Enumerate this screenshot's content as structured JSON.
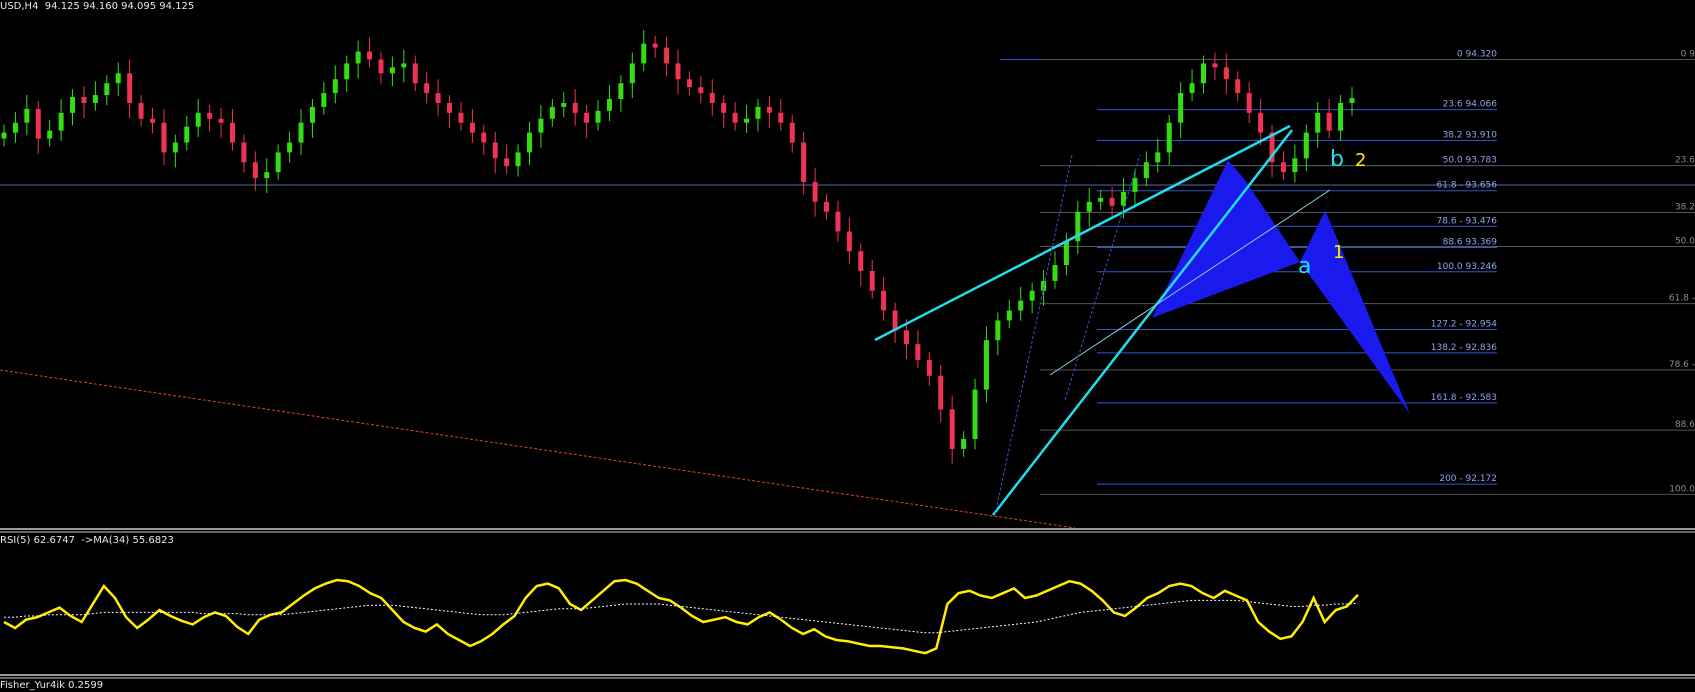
{
  "main": {
    "header": "USD,H4  94.125 94.160 94.095 94.125",
    "wave_labels": {
      "a": "a",
      "b": "b",
      "one": "1",
      "two": "2"
    },
    "fib_right_a": [
      {
        "label": "0 94.320",
        "level": 94.32
      },
      {
        "label": "23.6 94.066",
        "level": 94.066
      },
      {
        "label": "38.2 93.910",
        "level": 93.91
      },
      {
        "label": "50.0 93.783",
        "level": 93.783
      },
      {
        "label": "61.8 - 93.656",
        "level": 93.656
      },
      {
        "label": "78.6 - 93.476",
        "level": 93.476
      },
      {
        "label": "88.6 93.369",
        "level": 93.369
      },
      {
        "label": "100.0 93.246",
        "level": 93.246
      },
      {
        "label": "127.2 - 92.954",
        "level": 92.954
      },
      {
        "label": "138.2 - 92.836",
        "level": 92.836
      },
      {
        "label": "161.8 - 92.583",
        "level": 92.583
      },
      {
        "label": "200 - 92.172",
        "level": 92.172
      }
    ],
    "fib_right_b": [
      {
        "label": "0 9",
        "level": 94.32
      },
      {
        "label": "23.6",
        "level": 93.783
      },
      {
        "label": "38.2",
        "level": 93.546
      },
      {
        "label": "50.0",
        "level": 93.374
      },
      {
        "label": "61.8 -",
        "level": 93.085
      },
      {
        "label": "78.6 -",
        "level": 92.75
      },
      {
        "label": "88.6",
        "level": 92.445
      },
      {
        "label": "100.0",
        "level": 92.12
      }
    ]
  },
  "rsi": {
    "header": "RSI(5) 62.6747  ->MA(34) 55.6823",
    "value": 62.6747,
    "ma": 55.6823
  },
  "fisher": {
    "header": "Fisher_Yur4ik 0.2599",
    "value": 0.2599
  },
  "colors": {
    "bull": "#33dd11",
    "bear": "#ee3355",
    "cyan": "#22ddee",
    "blue": "#1a1aee",
    "fib": "#3355cc",
    "rsi": "#ffee00",
    "trend": "#dd4422"
  },
  "chart_data": {
    "type": "candlestick",
    "symbol": "USD",
    "timeframe": "H4",
    "ohlc_last": [
      94.125,
      94.16,
      94.095,
      94.125
    ],
    "close_series": [
      93.95,
      94.0,
      94.07,
      93.92,
      93.96,
      94.05,
      94.13,
      94.1,
      94.14,
      94.2,
      94.25,
      94.1,
      94.02,
      94.0,
      93.85,
      93.9,
      93.98,
      94.05,
      94.02,
      94.0,
      93.9,
      93.8,
      93.72,
      93.75,
      93.85,
      93.9,
      94.0,
      94.08,
      94.15,
      94.22,
      94.3,
      94.36,
      94.32,
      94.25,
      94.28,
      94.3,
      94.2,
      94.15,
      94.1,
      94.05,
      94.0,
      93.95,
      93.9,
      93.82,
      93.78,
      93.85,
      93.95,
      94.02,
      94.08,
      94.1,
      94.05,
      94.0,
      94.06,
      94.12,
      94.2,
      94.3,
      94.4,
      94.38,
      94.3,
      94.22,
      94.18,
      94.15,
      94.1,
      94.05,
      94.0,
      94.02,
      94.08,
      94.05,
      94.0,
      93.9,
      93.7,
      93.6,
      93.55,
      93.45,
      93.35,
      93.25,
      93.15,
      93.05,
      92.95,
      92.88,
      92.8,
      92.72,
      92.55,
      92.35,
      92.4,
      92.65,
      92.9,
      93.0,
      93.05,
      93.1,
      93.15,
      93.2,
      93.28,
      93.4,
      93.55,
      93.6,
      93.62,
      93.58,
      93.65,
      93.72,
      93.8,
      93.85,
      94.0,
      94.15,
      94.2,
      94.3,
      94.28,
      94.22,
      94.15,
      94.05,
      93.95,
      93.8,
      93.75,
      93.82,
      93.95,
      94.05,
      93.96,
      94.1,
      94.125
    ],
    "rsi_series": [
      40,
      35,
      42,
      44,
      48,
      52,
      45,
      40,
      55,
      70,
      60,
      44,
      35,
      42,
      50,
      45,
      41,
      38,
      44,
      48,
      45,
      36,
      30,
      42,
      46,
      48,
      55,
      62,
      68,
      72,
      75,
      74,
      70,
      64,
      60,
      50,
      40,
      35,
      32,
      38,
      30,
      25,
      20,
      24,
      30,
      38,
      45,
      60,
      70,
      72,
      68,
      55,
      50,
      58,
      66,
      74,
      75,
      72,
      66,
      60,
      58,
      52,
      45,
      40,
      42,
      44,
      40,
      38,
      44,
      48,
      42,
      35,
      30,
      34,
      28,
      25,
      24,
      22,
      20,
      20,
      19,
      18,
      16,
      14,
      18,
      55,
      64,
      66,
      62,
      60,
      64,
      68,
      60,
      62,
      66,
      70,
      74,
      72,
      66,
      58,
      48,
      45,
      52,
      60,
      64,
      70,
      72,
      70,
      64,
      60,
      66,
      62,
      58,
      40,
      32,
      26,
      28,
      40,
      60,
      40,
      50,
      53,
      62.67
    ],
    "rsi_ma34": [
      44,
      44,
      45,
      45,
      46,
      46,
      46,
      46,
      47,
      48,
      48,
      48,
      48,
      48,
      48,
      48,
      48,
      48,
      47,
      47,
      47,
      47,
      46,
      46,
      46,
      46,
      47,
      48,
      49,
      50,
      51,
      52,
      53,
      54,
      54,
      54,
      53,
      52,
      51,
      50,
      49,
      48,
      47,
      46,
      46,
      46,
      47,
      48,
      49,
      50,
      51,
      51,
      51,
      52,
      53,
      54,
      55,
      55,
      55,
      55,
      54,
      53,
      52,
      51,
      50,
      49,
      48,
      47,
      46,
      45,
      44,
      43,
      42,
      41,
      40,
      39,
      38,
      37,
      36,
      35,
      34,
      33,
      32,
      31,
      31,
      32,
      33,
      34,
      35,
      36,
      37,
      38,
      39,
      40,
      42,
      44,
      46,
      48,
      49,
      50,
      51,
      52,
      53,
      54,
      55,
      56,
      57,
      58,
      58,
      58,
      58,
      58,
      57,
      56,
      55,
      54,
      53,
      53,
      54,
      54,
      55,
      55,
      55.68
    ],
    "ylim_main": [
      91.95,
      94.55
    ],
    "rsi_range": [
      0,
      100
    ]
  }
}
